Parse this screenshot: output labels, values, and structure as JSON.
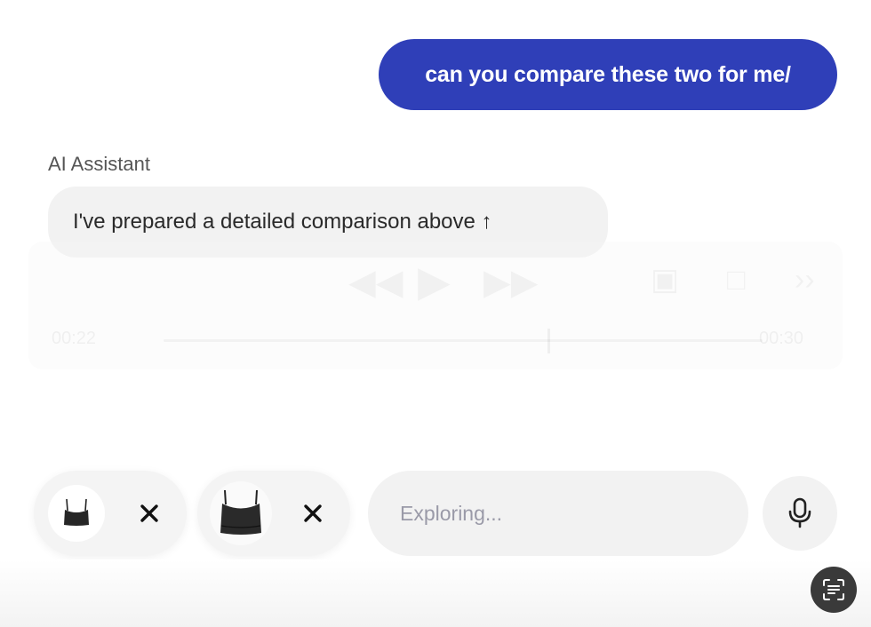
{
  "chat": {
    "user_message": "can you compare these two for me/",
    "assistant_name": "AI Assistant",
    "assistant_message": "I've prepared a detailed comparison above ↑"
  },
  "player_overlay": {
    "elapsed": "00:22",
    "duration": "00:30",
    "progress": 0.64,
    "icons": [
      "rewind-icon",
      "play-icon",
      "fast-forward-icon",
      "picture-in-picture-icon",
      "share-icon",
      "expand-icon"
    ]
  },
  "composer": {
    "attachments": [
      {
        "name": "black-crop-top-small",
        "remove_icon": "close-icon"
      },
      {
        "name": "black-crop-top-large",
        "remove_icon": "close-icon"
      }
    ],
    "placeholder": "Exploring...",
    "mic_icon": "microphone-icon"
  },
  "scan_button_icon": "text-scan-icon",
  "colors": {
    "user_bubble": "#2f3fb8",
    "assistant_bubble": "#f2f2f2",
    "scan_button": "#3a3a3a"
  }
}
